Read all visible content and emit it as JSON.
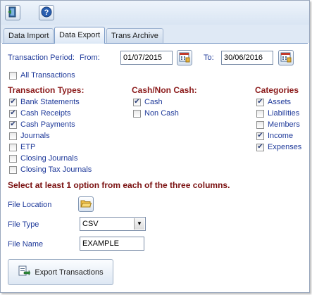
{
  "toolbar": {
    "buttons": [
      {
        "icon": "exit-icon"
      },
      {
        "icon": "help-icon",
        "glyph": "?"
      }
    ]
  },
  "tabs": [
    {
      "label": "Data Import"
    },
    {
      "label": "Data Export",
      "active": true
    },
    {
      "label": "Trans Archive"
    }
  ],
  "period": {
    "label": "Transaction Period:",
    "from_label": "From:",
    "from_value": "01/07/2015",
    "to_label": "To:",
    "to_value": "30/06/2016"
  },
  "all_transactions": {
    "label": "All Transactions",
    "checked": false
  },
  "transaction_types": {
    "heading": "Transaction Types:",
    "items": [
      {
        "label": "Bank Statements",
        "checked": true
      },
      {
        "label": "Cash Receipts",
        "checked": true
      },
      {
        "label": "Cash Payments",
        "checked": true
      },
      {
        "label": "Journals",
        "checked": false
      },
      {
        "label": "ETP",
        "checked": false
      },
      {
        "label": "Closing Journals",
        "checked": false
      },
      {
        "label": "Closing Tax Journals",
        "checked": false
      }
    ]
  },
  "cash_noncash": {
    "heading": "Cash/Non Cash:",
    "items": [
      {
        "label": "Cash",
        "checked": true
      },
      {
        "label": "Non Cash",
        "checked": false
      }
    ]
  },
  "categories": {
    "heading": "Categories",
    "items": [
      {
        "label": "Assets",
        "checked": true
      },
      {
        "label": "Liabilities",
        "checked": false
      },
      {
        "label": "Members",
        "checked": false
      },
      {
        "label": "Income",
        "checked": true
      },
      {
        "label": "Expenses",
        "checked": true
      }
    ]
  },
  "instruction": "Select at least 1 option from each of the three columns.",
  "file_location": {
    "label": "File Location"
  },
  "file_type": {
    "label": "File Type",
    "value": "CSV"
  },
  "file_name": {
    "label": "File Name",
    "value": "EXAMPLE"
  },
  "export_button": {
    "label": "Export Transactions"
  },
  "colors": {
    "heading": "#8b1a1a",
    "label_blue": "#1f3a9a",
    "tab_border": "#7d9cc7",
    "checkmark": "#2b3f78"
  }
}
